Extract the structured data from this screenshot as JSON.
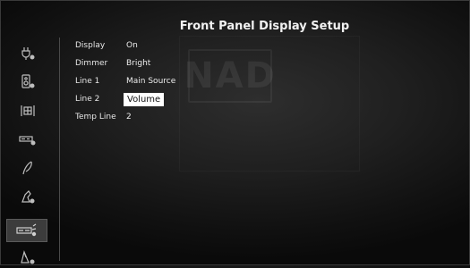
{
  "screen": {
    "title": "Front Panel Display Setup"
  },
  "watermark": {
    "text": "NAD"
  },
  "settings": [
    {
      "label": "Display",
      "value": "On"
    },
    {
      "label": "Dimmer",
      "value": "Bright"
    },
    {
      "label": "Line 1",
      "value": "Main Source"
    },
    {
      "label": "Line 2",
      "value": "Volume",
      "selected": true
    },
    {
      "label": "Temp Line",
      "value": "2"
    }
  ],
  "sidebar": {
    "items": [
      {
        "icon": "input-plug-settings-icon"
      },
      {
        "icon": "speaker-settings-icon"
      },
      {
        "icon": "listening-mode-icon"
      },
      {
        "icon": "amplifier-settings-icon"
      },
      {
        "icon": "audio-processing-icon"
      },
      {
        "icon": "zone-settings-icon"
      },
      {
        "icon": "front-panel-display-icon",
        "selected": true
      },
      {
        "icon": "general-settings-icon"
      }
    ]
  },
  "colors": {
    "background": "#1f1f1f",
    "text": "#e8e8e8",
    "highlight": "#ffffff",
    "highlight_text": "#111111"
  }
}
